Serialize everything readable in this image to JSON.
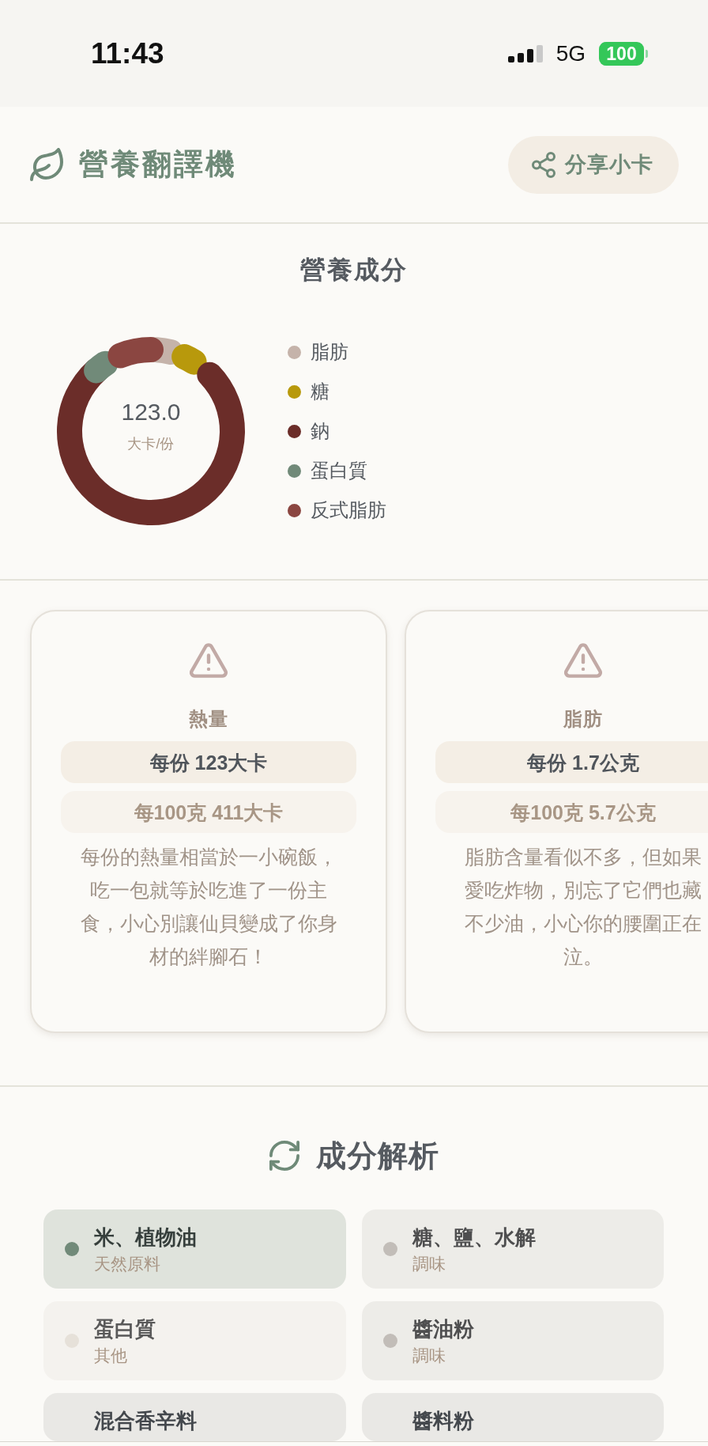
{
  "status_bar": {
    "time": "11:43",
    "network": "5G",
    "battery": "100"
  },
  "header": {
    "title": "營養翻譯機",
    "share_button": "分享小卡"
  },
  "nutrition": {
    "title": "營養成分",
    "center_value": "123.0",
    "center_unit": "大卡/份",
    "legend": [
      {
        "label": "脂肪",
        "color": "#c5b3aa"
      },
      {
        "label": "糖",
        "color": "#b8990c"
      },
      {
        "label": "鈉",
        "color": "#6b2d29"
      },
      {
        "label": "蛋白質",
        "color": "#718a79"
      },
      {
        "label": "反式脂肪",
        "color": "#8b4641"
      }
    ]
  },
  "nutrient_cards": [
    {
      "title": "熱量",
      "per_serving": "每份 123大卡",
      "per_100g": "每100克 411大卡",
      "description": "每份的熱量相當於一小碗飯，吃一包就等於吃進了一份主食，小心別讓仙貝變成了你身材的絆腳石！"
    },
    {
      "title": "脂肪",
      "per_serving": "每份 1.7公克",
      "per_100g": "每100克 5.7公克",
      "description": "脂肪含量看似不多，但如果愛吃炸物，別忘了它們也藏不少油，小心你的腰圍正在泣。"
    }
  ],
  "ingredients": {
    "title": "成分解析",
    "items": [
      {
        "name": "米、植物油",
        "category": "天然原料",
        "color": "#718a79"
      },
      {
        "name": "糖、鹽、水解",
        "category": "調味",
        "color": "#c2bdb8"
      },
      {
        "name": "蛋白質",
        "category": "其他",
        "color": "#e6e1d9"
      },
      {
        "name": "醬油粉",
        "category": "調味",
        "color": "#c2bdb8"
      },
      {
        "name": "混合香辛料"
      },
      {
        "name": "醬料粉"
      }
    ]
  }
}
